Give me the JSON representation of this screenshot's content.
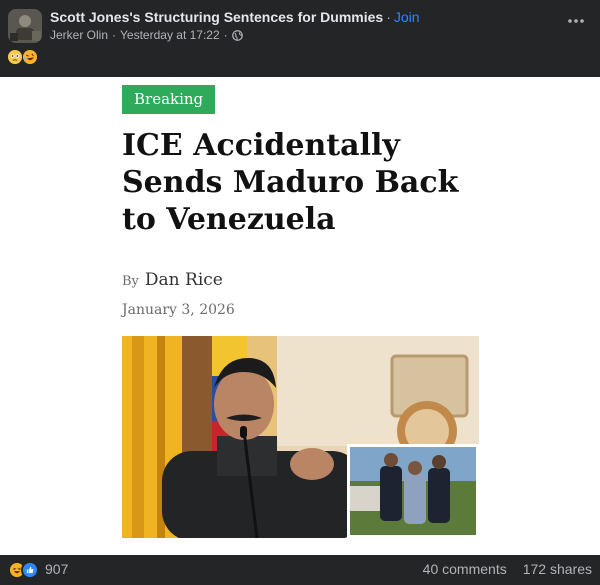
{
  "post": {
    "group_name": "Scott Jones's Structuring Sentences for Dummies",
    "separator": "·",
    "join_label": "Join",
    "author": "Jerker Olin",
    "timestamp": "Yesterday at 17:22",
    "meta_separator": "·",
    "audience_icon": "globe-icon",
    "more_icon": "more-horizontal-icon",
    "text_emojis": [
      "crying-face-emoji",
      "rolling-on-floor-laughing-emoji"
    ]
  },
  "article": {
    "badge": "Breaking",
    "headline": "ICE Accidentally Sends Maduro Back to Venezuela",
    "by_label": "By",
    "author": "Dan Rice",
    "date": "January 3, 2026",
    "image_alt": "Man speaking at microphone with inset of ICE agents escorting a person"
  },
  "footer": {
    "reaction_icons": [
      "haha-reaction-icon",
      "like-reaction-icon"
    ],
    "reaction_count": "907",
    "comments": "40 comments",
    "shares": "172 shares"
  },
  "colors": {
    "header_bg": "#242526",
    "link_blue": "#2d88ff",
    "badge_green": "#2eaa5b"
  }
}
